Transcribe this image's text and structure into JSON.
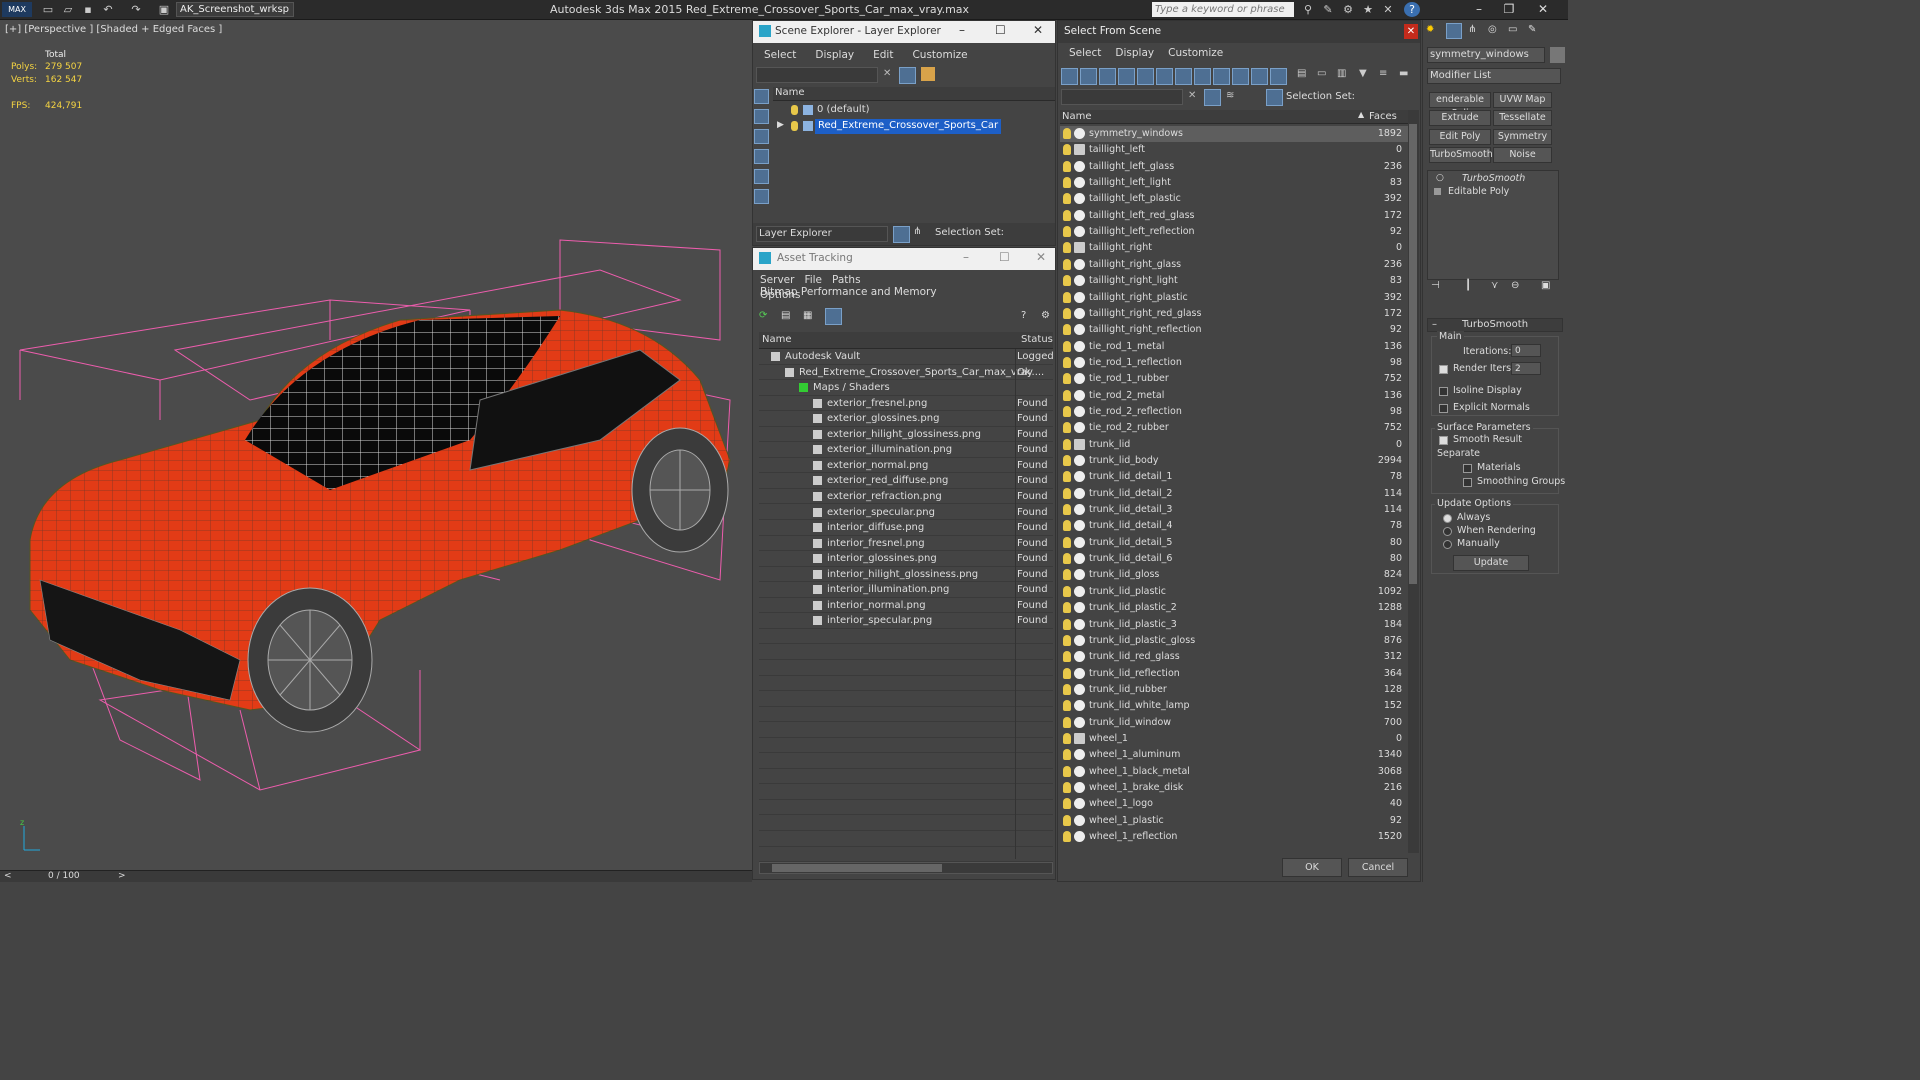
{
  "titlebar": {
    "app_title": "Autodesk 3ds Max  2015     Red_Extreme_Crossover_Sports_Car_max_vray.max",
    "workspace": "AK_Screenshot_wrksp",
    "search_placeholder": "Type a keyword or phrase"
  },
  "viewport": {
    "label": "[+] [Perspective ] [Shaded + Edged Faces ]",
    "stats": {
      "total_label": "Total",
      "polys_label": "Polys:",
      "polys": "279 507",
      "verts_label": "Verts:",
      "verts": "162 547",
      "fps_label": "FPS:",
      "fps": "424,791"
    }
  },
  "timeline": {
    "frame": "0 / 100"
  },
  "scene_explorer": {
    "title": "Scene Explorer - Layer Explorer",
    "menu": [
      "Select",
      "Display",
      "Edit",
      "Customize"
    ],
    "column": "Name",
    "layers": [
      {
        "label": "0 (default)",
        "selected": false
      },
      {
        "label": "Red_Extreme_Crossover_Sports_Car",
        "selected": true
      }
    ],
    "footer_dropdown": "Layer Explorer",
    "selection_set": "Selection Set:"
  },
  "asset_tracking": {
    "title": "Asset Tracking",
    "menu": [
      "Server",
      "File",
      "Paths",
      "Bitmap Performance and Memory"
    ],
    "menu2": "Options",
    "col_name": "Name",
    "col_status": "Status",
    "rows": [
      {
        "name": "Autodesk Vault",
        "status": "Logged",
        "indent": 0
      },
      {
        "name": "Red_Extreme_Crossover_Sports_Car_max_vray....",
        "status": "Ok",
        "indent": 1
      },
      {
        "name": "Maps / Shaders",
        "status": "",
        "indent": 2
      },
      {
        "name": "exterior_fresnel.png",
        "status": "Found",
        "indent": 3
      },
      {
        "name": "exterior_glossines.png",
        "status": "Found",
        "indent": 3
      },
      {
        "name": "exterior_hilight_glossiness.png",
        "status": "Found",
        "indent": 3
      },
      {
        "name": "exterior_illumination.png",
        "status": "Found",
        "indent": 3
      },
      {
        "name": "exterior_normal.png",
        "status": "Found",
        "indent": 3
      },
      {
        "name": "exterior_red_diffuse.png",
        "status": "Found",
        "indent": 3
      },
      {
        "name": "exterior_refraction.png",
        "status": "Found",
        "indent": 3
      },
      {
        "name": "exterior_specular.png",
        "status": "Found",
        "indent": 3
      },
      {
        "name": "interior_diffuse.png",
        "status": "Found",
        "indent": 3
      },
      {
        "name": "interior_fresnel.png",
        "status": "Found",
        "indent": 3
      },
      {
        "name": "interior_glossines.png",
        "status": "Found",
        "indent": 3
      },
      {
        "name": "interior_hilight_glossiness.png",
        "status": "Found",
        "indent": 3
      },
      {
        "name": "interior_illumination.png",
        "status": "Found",
        "indent": 3
      },
      {
        "name": "interior_normal.png",
        "status": "Found",
        "indent": 3
      },
      {
        "name": "interior_specular.png",
        "status": "Found",
        "indent": 3
      }
    ]
  },
  "select_from_scene": {
    "title": "Select From Scene",
    "menu": [
      "Select",
      "Display",
      "Customize"
    ],
    "selection_set": "Selection Set:",
    "col_name": "Name",
    "col_faces": "Faces",
    "ok": "OK",
    "cancel": "Cancel",
    "rows": [
      {
        "name": "symmetry_windows",
        "faces": "1892",
        "selected": true
      },
      {
        "name": "taillight_left",
        "faces": "0"
      },
      {
        "name": "taillight_left_glass",
        "faces": "236"
      },
      {
        "name": "taillight_left_light",
        "faces": "83"
      },
      {
        "name": "taillight_left_plastic",
        "faces": "392"
      },
      {
        "name": "taillight_left_red_glass",
        "faces": "172"
      },
      {
        "name": "taillight_left_reflection",
        "faces": "92"
      },
      {
        "name": "taillight_right",
        "faces": "0"
      },
      {
        "name": "taillight_right_glass",
        "faces": "236"
      },
      {
        "name": "taillight_right_light",
        "faces": "83"
      },
      {
        "name": "taillight_right_plastic",
        "faces": "392"
      },
      {
        "name": "taillight_right_red_glass",
        "faces": "172"
      },
      {
        "name": "taillight_right_reflection",
        "faces": "92"
      },
      {
        "name": "tie_rod_1_metal",
        "faces": "136"
      },
      {
        "name": "tie_rod_1_reflection",
        "faces": "98"
      },
      {
        "name": "tie_rod_1_rubber",
        "faces": "752"
      },
      {
        "name": "tie_rod_2_metal",
        "faces": "136"
      },
      {
        "name": "tie_rod_2_reflection",
        "faces": "98"
      },
      {
        "name": "tie_rod_2_rubber",
        "faces": "752"
      },
      {
        "name": "trunk_lid",
        "faces": "0"
      },
      {
        "name": "trunk_lid_body",
        "faces": "2994"
      },
      {
        "name": "trunk_lid_detail_1",
        "faces": "78"
      },
      {
        "name": "trunk_lid_detail_2",
        "faces": "114"
      },
      {
        "name": "trunk_lid_detail_3",
        "faces": "114"
      },
      {
        "name": "trunk_lid_detail_4",
        "faces": "78"
      },
      {
        "name": "trunk_lid_detail_5",
        "faces": "80"
      },
      {
        "name": "trunk_lid_detail_6",
        "faces": "80"
      },
      {
        "name": "trunk_lid_gloss",
        "faces": "824"
      },
      {
        "name": "trunk_lid_plastic",
        "faces": "1092"
      },
      {
        "name": "trunk_lid_plastic_2",
        "faces": "1288"
      },
      {
        "name": "trunk_lid_plastic_3",
        "faces": "184"
      },
      {
        "name": "trunk_lid_plastic_gloss",
        "faces": "876"
      },
      {
        "name": "trunk_lid_red_glass",
        "faces": "312"
      },
      {
        "name": "trunk_lid_reflection",
        "faces": "364"
      },
      {
        "name": "trunk_lid_rubber",
        "faces": "128"
      },
      {
        "name": "trunk_lid_white_lamp",
        "faces": "152"
      },
      {
        "name": "trunk_lid_window",
        "faces": "700"
      },
      {
        "name": "wheel_1",
        "faces": "0"
      },
      {
        "name": "wheel_1_aluminum",
        "faces": "1340"
      },
      {
        "name": "wheel_1_black_metal",
        "faces": "3068"
      },
      {
        "name": "wheel_1_brake_disk",
        "faces": "216"
      },
      {
        "name": "wheel_1_logo",
        "faces": "40"
      },
      {
        "name": "wheel_1_plastic",
        "faces": "92"
      },
      {
        "name": "wheel_1_reflection",
        "faces": "1520"
      }
    ]
  },
  "command_panel": {
    "object_name": "symmetry_windows",
    "modifier_list": "Modifier List",
    "buttons": [
      "enderable Spli",
      "UVW Map",
      "Extrude",
      "Tessellate",
      "Edit Poly",
      "Symmetry",
      "TurboSmooth",
      "Noise"
    ],
    "stack": [
      "TurboSmooth",
      "Editable Poly"
    ],
    "rollout_title": "TurboSmooth",
    "main_group": "Main",
    "iterations_label": "Iterations:",
    "iterations": "0",
    "render_iters_label": "Render Iters:",
    "render_iters": "2",
    "isoline": "Isoline Display",
    "explicit_normals": "Explicit Normals",
    "surface_group": "Surface Parameters",
    "smooth_result": "Smooth Result",
    "separate": "Separate",
    "materials": "Materials",
    "smoothing_groups": "Smoothing Groups",
    "update_group": "Update Options",
    "always": "Always",
    "when_rendering": "When Rendering",
    "manually": "Manually",
    "update_button": "Update"
  }
}
